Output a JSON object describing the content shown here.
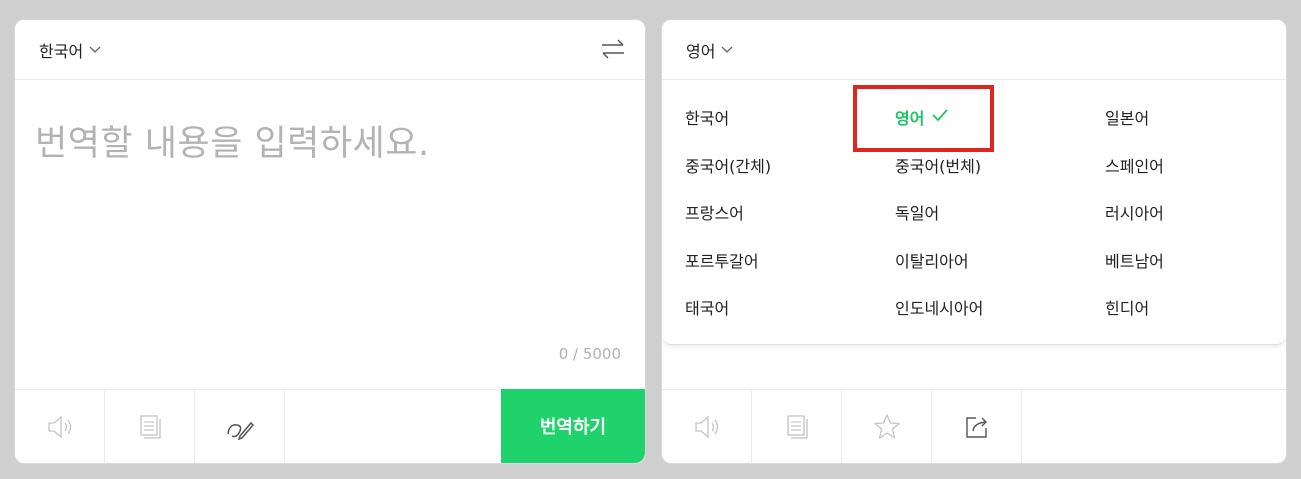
{
  "source": {
    "language": "한국어",
    "placeholder": "번역할 내용을 입력하세요.",
    "counter": "0 / 5000",
    "translate_button": "번역하기"
  },
  "target": {
    "language": "영어",
    "options": [
      "한국어",
      "영어",
      "일본어",
      "중국어(간체)",
      "중국어(번체)",
      "스페인어",
      "프랑스어",
      "독일어",
      "러시아어",
      "포르투갈어",
      "이탈리아어",
      "베트남어",
      "태국어",
      "인도네시아어",
      "힌디어"
    ],
    "selected": "영어"
  },
  "colors": {
    "accent_green": "#1fd26c",
    "highlight_red": "#e0241f"
  },
  "icons": [
    "chevron-down-icon",
    "swap-icon",
    "speaker-icon",
    "copy-icon",
    "handwriting-icon",
    "star-icon",
    "share-icon",
    "check-icon"
  ]
}
